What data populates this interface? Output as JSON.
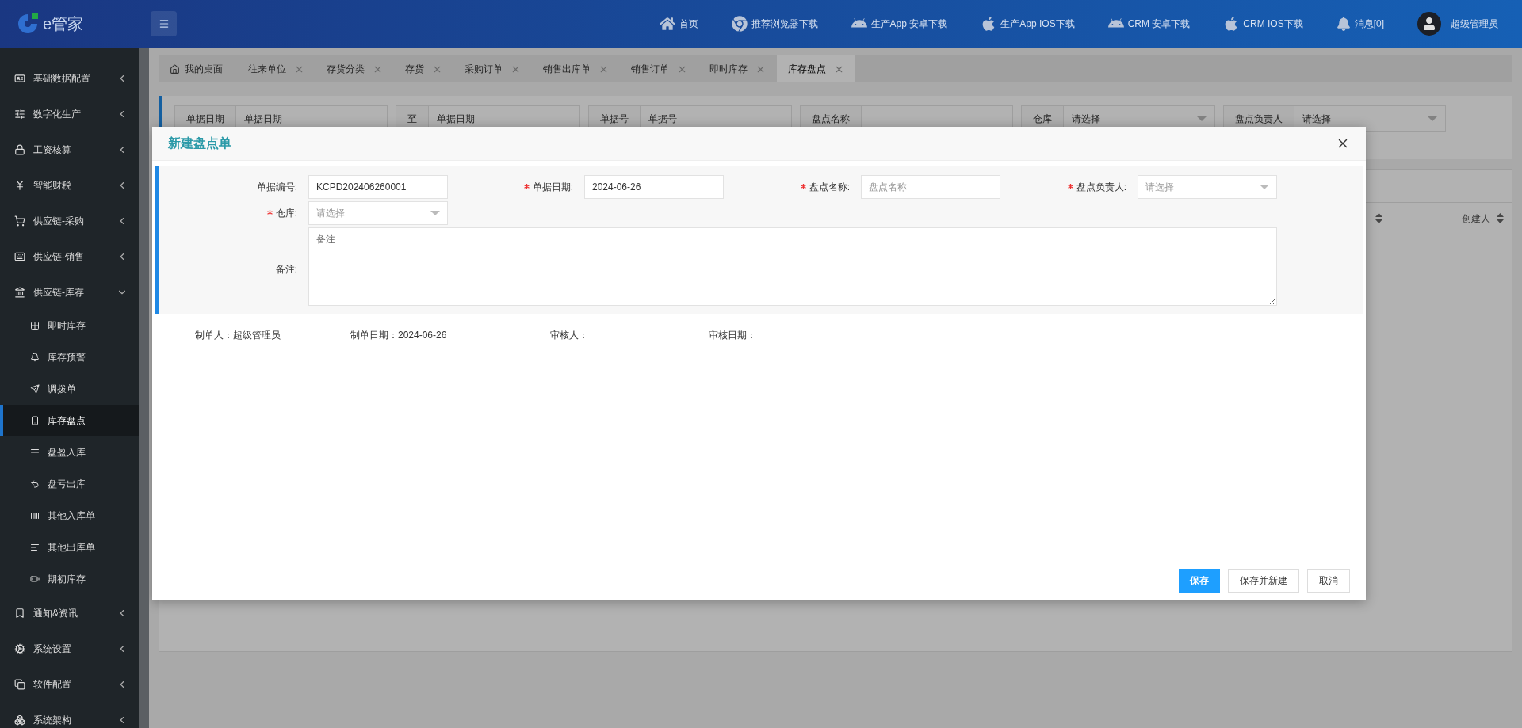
{
  "header": {
    "logo_text": "e管家",
    "nav": [
      {
        "label": "首页",
        "kind": "home"
      },
      {
        "label": "推荐浏览器下载",
        "kind": "browser"
      },
      {
        "label": "生产App 安卓下载",
        "kind": "android"
      },
      {
        "label": "生产App IOS下载",
        "kind": "apple"
      },
      {
        "label": "CRM 安卓下载",
        "kind": "android"
      },
      {
        "label": "CRM IOS下载",
        "kind": "apple"
      },
      {
        "label": "消息[0]",
        "kind": "bell"
      }
    ],
    "user": "超级管理员"
  },
  "sidebar": {
    "items": [
      {
        "label": "基础数据配置",
        "expanded": false,
        "selected": false
      },
      {
        "label": "数字化生产",
        "expanded": false,
        "selected": false
      },
      {
        "label": "工资核算",
        "expanded": false,
        "selected": false
      },
      {
        "label": "智能财税",
        "expanded": false,
        "selected": false
      },
      {
        "label": "供应链-采购",
        "expanded": false,
        "selected": false
      },
      {
        "label": "供应链-销售",
        "expanded": false,
        "selected": false
      },
      {
        "label": "供应链-库存",
        "expanded": true,
        "selected": false,
        "children": [
          {
            "label": "即时库存",
            "selected": false
          },
          {
            "label": "库存预警",
            "selected": false
          },
          {
            "label": "调拨单",
            "selected": false
          },
          {
            "label": "库存盘点",
            "selected": true
          },
          {
            "label": "盘盈入库",
            "selected": false
          },
          {
            "label": "盘亏出库",
            "selected": false
          },
          {
            "label": "其他入库单",
            "selected": false
          },
          {
            "label": "其他出库单",
            "selected": false
          },
          {
            "label": "期初库存",
            "selected": false
          }
        ]
      },
      {
        "label": "通知&资讯",
        "expanded": false,
        "selected": false
      },
      {
        "label": "系统设置",
        "expanded": false,
        "selected": false
      },
      {
        "label": "软件配置",
        "expanded": false,
        "selected": false
      },
      {
        "label": "系统架构",
        "expanded": false,
        "selected": false
      }
    ]
  },
  "tabs": [
    {
      "label": "我的桌面",
      "selected": false,
      "closable": false
    },
    {
      "label": "往来单位",
      "selected": false,
      "closable": true
    },
    {
      "label": "存货分类",
      "selected": false,
      "closable": true
    },
    {
      "label": "存货",
      "selected": false,
      "closable": true
    },
    {
      "label": "采购订单",
      "selected": false,
      "closable": true
    },
    {
      "label": "销售出库单",
      "selected": false,
      "closable": true
    },
    {
      "label": "销售订单",
      "selected": false,
      "closable": true
    },
    {
      "label": "即时库存",
      "selected": false,
      "closable": true
    },
    {
      "label": "库存盘点",
      "selected": true,
      "closable": true
    }
  ],
  "filters": [
    {
      "label": "单据日期",
      "kind": "text",
      "placeholder": "单据日期"
    },
    {
      "label": "至",
      "kind": "text",
      "placeholder": "单据日期"
    },
    {
      "label": "单据号",
      "kind": "text",
      "placeholder": "单据号"
    },
    {
      "label": "盘点名称",
      "kind": "text"
    },
    {
      "label": "仓库",
      "kind": "select",
      "placeholder": "请选择"
    },
    {
      "label": "盘点负责人",
      "kind": "select",
      "placeholder": "请选择"
    }
  ],
  "table": {
    "columns": [
      {
        "label": "创建人"
      }
    ]
  },
  "modal": {
    "title": "新建盘点单",
    "fields": [
      {
        "label": "单据编号:",
        "required": false,
        "kind": "text",
        "value": "KCPD202406260001"
      },
      {
        "label": "单据日期:",
        "required": true,
        "kind": "text",
        "value": "2024-06-26"
      },
      {
        "label": "盘点名称:",
        "required": true,
        "kind": "text",
        "placeholder": "盘点名称"
      },
      {
        "label": "盘点负责人:",
        "required": true,
        "kind": "select",
        "placeholder": "请选择"
      },
      {
        "label": "仓库:",
        "required": true,
        "kind": "select",
        "placeholder": "请选择"
      },
      {
        "label": "备注:",
        "required": false,
        "kind": "textarea",
        "placeholder": "备注"
      }
    ],
    "info": [
      {
        "label": "制单人：",
        "value": "超级管理员"
      },
      {
        "label": "制单日期：",
        "value": "2024-06-26"
      },
      {
        "label": "审核人："
      },
      {
        "label": "审核日期："
      }
    ],
    "buttons": [
      {
        "label": "保存",
        "kind": "primary"
      },
      {
        "label": "保存并新建",
        "kind": "default"
      },
      {
        "label": "取消",
        "kind": "default"
      }
    ]
  }
}
